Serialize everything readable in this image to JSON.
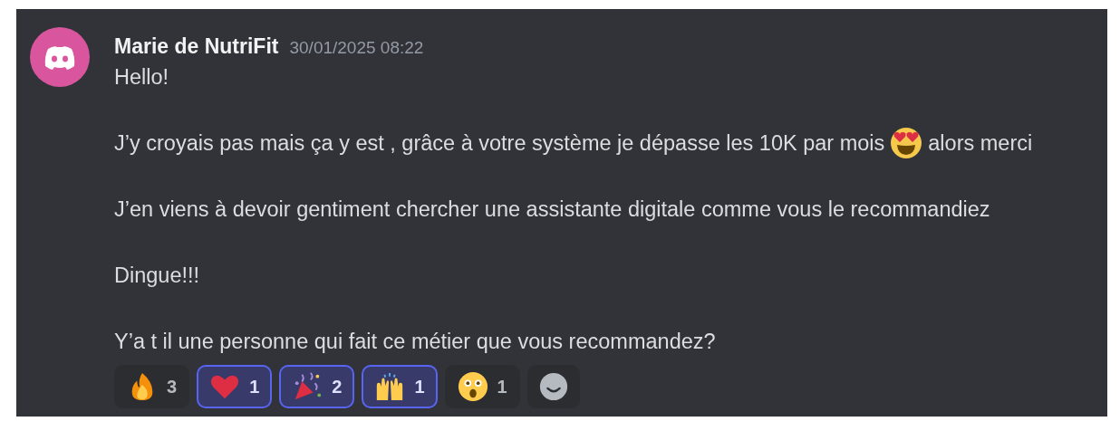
{
  "message": {
    "author": "Marie de NutriFit",
    "timestamp": "30/01/2025 08:22",
    "lines": [
      {
        "text": "Hello!"
      },
      {
        "text": "J’y croyais pas mais ça y est , grâce à votre système je dépasse les 10K par mois",
        "kind": "heart-eyes",
        "text_after": "alors merci"
      },
      {
        "text": "J’en viens à devoir gentiment chercher une assistante digitale comme vous le recommandiez"
      },
      {
        "text": "Dingue!!!"
      },
      {
        "text": "Y’a t il une personne qui fait ce métier que vous recommandez?"
      }
    ],
    "reactions": [
      {
        "kind": "fire",
        "count": "3",
        "selected": false
      },
      {
        "kind": "heart",
        "count": "1",
        "selected": true
      },
      {
        "kind": "party-popper",
        "count": "2",
        "selected": true
      },
      {
        "kind": "raised-hands",
        "count": "1",
        "selected": true
      },
      {
        "kind": "astonished",
        "count": "1",
        "selected": false
      }
    ]
  }
}
